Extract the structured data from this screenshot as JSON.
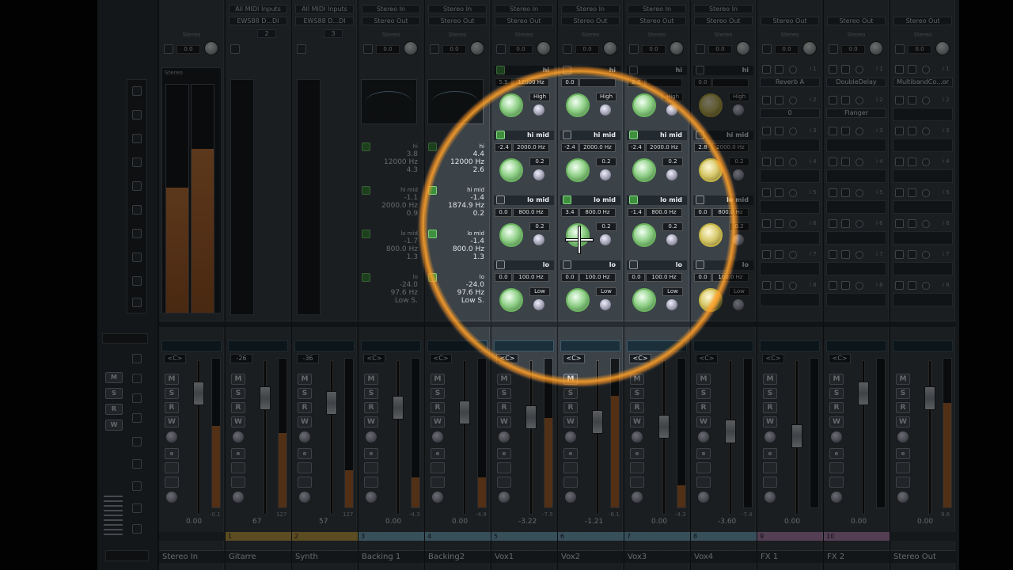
{
  "channels": [
    {
      "name": "Stereo In",
      "number": "",
      "color": "",
      "kind": "audio-in",
      "in": "",
      "out": "",
      "routing": "Stereo",
      "vol": "0.00",
      "peak": "-0.1",
      "pan": "<C>",
      "meter": [
        0.55,
        0.72
      ],
      "input_label": "Stereo",
      "eq": "meter"
    },
    {
      "name": "Gitarre",
      "number": "1",
      "color": "#c9a94a",
      "kind": "instrument",
      "in": "All MIDI Inputs",
      "out": "EWS88 D...DI",
      "channel": "2",
      "routing": "",
      "vol": "67",
      "peak": "127",
      "pan": "-26",
      "meter": [
        0.5
      ],
      "eq": "midi"
    },
    {
      "name": "Synth",
      "number": "2",
      "color": "#c9a94a",
      "kind": "instrument",
      "in": "All MIDI Inputs",
      "out": "EWS88 D...DI",
      "channel": "3",
      "routing": "",
      "vol": "57",
      "peak": "127",
      "pan": "-36",
      "meter": [
        0.25
      ],
      "eq": "midi"
    },
    {
      "name": "Backing 1",
      "number": "3",
      "color": "#7ab0c8",
      "kind": "audio",
      "in": "Stereo In",
      "out": "Stereo Out",
      "routing": "Stereo",
      "vol": "0.00",
      "peak": "-4.3",
      "pan": "<C>",
      "meter": [
        0.2
      ],
      "eq": "text",
      "eqtext": [
        [
          "hi",
          "3.8",
          "12000 Hz",
          "4.3"
        ],
        [
          "hi mid",
          "-1.1",
          "2000.0 Hz",
          "0.9"
        ],
        [
          "lo mid",
          "-1.7",
          "800.0 Hz",
          "1.3"
        ],
        [
          "lo",
          "-24.0",
          "97.6 Hz",
          "Low S."
        ]
      ]
    },
    {
      "name": "Backing2",
      "number": "4",
      "color": "#7ab0c8",
      "kind": "audio",
      "in": "Stereo In",
      "out": "Stereo Out",
      "routing": "Stereo",
      "vol": "0.00",
      "peak": "-4.9",
      "pan": "<C>",
      "meter": [
        0.2
      ],
      "eq": "text",
      "eqtext": [
        [
          "hi",
          "4.4",
          "12000 Hz",
          "2.6"
        ],
        [
          "hi mid",
          "-1.4",
          "1874.9 Hz",
          "0.2"
        ],
        [
          "lo mid",
          "-1.4",
          "800.0 Hz",
          "1.3"
        ],
        [
          "lo",
          "-24.0",
          "97.6 Hz",
          "Low S."
        ]
      ]
    },
    {
      "name": "Vox1",
      "number": "5",
      "color": "#7ab0c8",
      "kind": "audio",
      "in": "Stereo In",
      "out": "Stereo Out",
      "routing": "Stereo",
      "vol": "-3.22",
      "peak": "-7.5",
      "pan": "<C>",
      "meter": [
        0.6
      ],
      "eq": "knobs",
      "bands": [
        {
          "label": "hi",
          "gain": "5.5",
          "freq": "12000 Hz",
          "q": "High",
          "on": true
        },
        {
          "label": "hi mid",
          "gain": "-2.4",
          "freq": "2000.0 Hz",
          "q": "0.2",
          "on": true
        },
        {
          "label": "lo mid",
          "gain": "0.0",
          "freq": "800.0 Hz",
          "q": "0.2",
          "on": false
        },
        {
          "label": "lo",
          "gain": "0.0",
          "freq": "100.0 Hz",
          "q": "Low",
          "on": false
        }
      ]
    },
    {
      "name": "Vox2",
      "number": "6",
      "color": "#7ab0c8",
      "kind": "audio",
      "in": "Stereo In",
      "out": "Stereo Out",
      "routing": "Stereo",
      "vol": "-1.21",
      "peak": "-6.1",
      "pan": "<C>",
      "meter": [
        0.75
      ],
      "eq": "knobs",
      "bands": [
        {
          "label": "hi",
          "gain": "0.0",
          "freq": "",
          "q": "High",
          "on": false
        },
        {
          "label": "hi mid",
          "gain": "-2.4",
          "freq": "2000.0 Hz",
          "q": "0.2",
          "on": false
        },
        {
          "label": "lo mid",
          "gain": "3.4",
          "freq": "800.0 Hz",
          "q": "0.2",
          "on": true
        },
        {
          "label": "lo",
          "gain": "0.0",
          "freq": "100.0 Hz",
          "q": "Low",
          "on": false
        }
      ]
    },
    {
      "name": "Vox3",
      "number": "7",
      "color": "#7ab0c8",
      "kind": "audio",
      "in": "Stereo In",
      "out": "Stereo Out",
      "routing": "Stereo",
      "vol": "0.00",
      "peak": "-4.3",
      "pan": "<C>",
      "meter": [
        0.15
      ],
      "eq": "knobs",
      "bands": [
        {
          "label": "hi",
          "gain": "0.0",
          "freq": "",
          "q": "High",
          "on": false
        },
        {
          "label": "hi mid",
          "gain": "-2.4",
          "freq": "2000.0 Hz",
          "q": "0.2",
          "on": true
        },
        {
          "label": "lo mid",
          "gain": "-1.4",
          "freq": "800.0 Hz",
          "q": "0.2",
          "on": true
        },
        {
          "label": "lo",
          "gain": "0.0",
          "freq": "100.0 Hz",
          "q": "Low",
          "on": false
        }
      ]
    },
    {
      "name": "Vox4",
      "number": "8",
      "color": "#7ab0c8",
      "kind": "audio",
      "in": "Stereo In",
      "out": "Stereo Out",
      "routing": "Stereo",
      "vol": "-3.60",
      "peak": "-7.4",
      "pan": "<C>",
      "meter": [
        0.0
      ],
      "eq": "knobs4",
      "bands": [
        {
          "label": "hi",
          "gain": "0.0",
          "freq": "",
          "q": "High",
          "on": false
        },
        {
          "label": "hi mid",
          "gain": "2.8",
          "freq": "2000.0 Hz",
          "q": "0.2",
          "on": false
        },
        {
          "label": "lo mid",
          "gain": "0.0",
          "freq": "800.0 Hz",
          "q": "0.2",
          "on": false
        },
        {
          "label": "lo",
          "gain": "0.0",
          "freq": "100.0 Hz",
          "q": "Low",
          "on": false
        }
      ]
    },
    {
      "name": "FX 1",
      "number": "9",
      "color": "#b88ab8",
      "kind": "fx",
      "in": "",
      "out": "Stereo Out",
      "routing": "Stereo",
      "vol": "0.00",
      "peak": "",
      "pan": "<C>",
      "meter": [
        0.0
      ],
      "eq": "inserts",
      "inserts": [
        "Reverb A",
        "0"
      ]
    },
    {
      "name": "FX 2",
      "number": "10",
      "color": "#b88ab8",
      "kind": "fx",
      "in": "",
      "out": "Stereo Out",
      "routing": "Stereo",
      "vol": "0.00",
      "peak": "",
      "pan": "<C>",
      "meter": [
        0.0
      ],
      "eq": "inserts",
      "inserts": [
        "DoubleDelay",
        "Flanger"
      ]
    },
    {
      "name": "Stereo Out",
      "number": "",
      "color": "",
      "kind": "out",
      "in": "",
      "out": "Stereo Out",
      "routing": "Stereo",
      "vol": "0.00",
      "peak": "9.6",
      "pan": "",
      "meter": [
        0.7
      ],
      "eq": "inserts",
      "inserts": [
        "MultibandCo...or",
        ""
      ]
    }
  ],
  "colors": {
    "accent": "#f0a030",
    "meter": "#c07030",
    "eq_on": "#4caf50"
  }
}
